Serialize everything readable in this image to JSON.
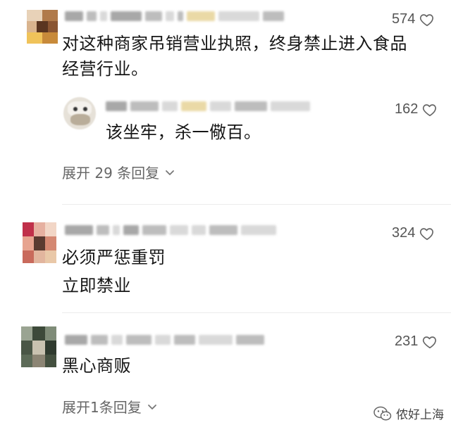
{
  "comments": [
    {
      "text_lines": [
        "对这种商家吊销营业执照，终身禁止进入食品",
        "经营行业。"
      ],
      "likes": "574",
      "replies": [
        {
          "text": "该坐牢，杀一儆百。",
          "likes": "162"
        }
      ],
      "expand_label": "展开 29 条回复"
    },
    {
      "text_lines": [
        "必须严惩重罚",
        "立即禁业"
      ],
      "likes": "324"
    },
    {
      "text_lines": [
        "黑心商贩"
      ],
      "likes": "231",
      "expand_label": "展开1条回复"
    }
  ],
  "watermark": {
    "text": "侬好上海",
    "icon": "wechat-icon"
  },
  "icons": {
    "like": "heart-outline-icon",
    "expand": "chevron-down-icon"
  }
}
